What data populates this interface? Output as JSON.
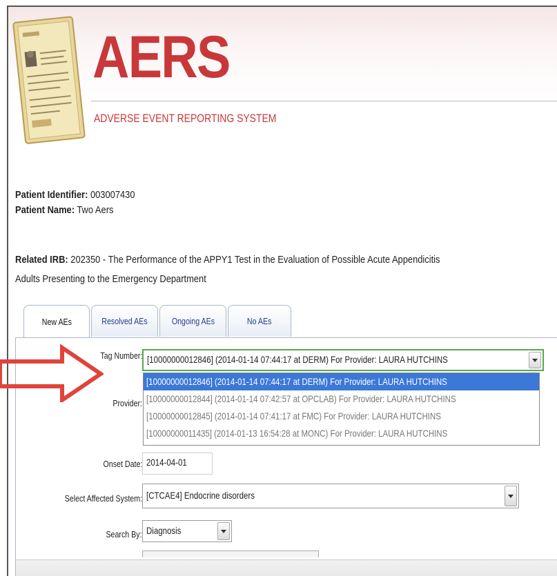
{
  "brand": {
    "title": "AERS",
    "subtitle": "ADVERSE EVENT REPORTING SYSTEM",
    "accent": "#c8383a"
  },
  "patient": {
    "identifier_label": "Patient Identifier:",
    "identifier_value": "003007430",
    "name_label": "Patient Name:",
    "name_value": "Two Aers"
  },
  "irb": {
    "label": "Related IRB:",
    "line1": "202350  - The Performance of the APPY1 Test in the Evaluation of Possible Acute Appendicitis",
    "line2": "Adults Presenting to the Emergency Department"
  },
  "tabs": [
    {
      "label": "New AEs",
      "active": true
    },
    {
      "label": "Resolved AEs",
      "active": false
    },
    {
      "label": "Ongoing AEs",
      "active": false
    },
    {
      "label": "No AEs",
      "active": false
    }
  ],
  "form": {
    "tag_number_label": "Tag Number:",
    "tag_number_value": "[10000000012846] (2014-01-14 07:44:17 at DERM) For Provider: LAURA HUTCHINS",
    "tag_options": [
      "[10000000012846] (2014-01-14 07:44:17 at DERM) For Provider: LAURA HUTCHINS",
      "[10000000012844] (2014-01-14 07:42:57 at OPCLAB) For Provider: LAURA HUTCHINS",
      "[10000000012845] (2014-01-14 07:41:17 at FMC) For Provider: LAURA HUTCHINS",
      "[10000000011435] (2014-01-13 16:54:28 at MONC) For Provider: LAURA HUTCHINS"
    ],
    "provider_label": "Provider:",
    "onset_date_label": "Onset Date:",
    "onset_date_value": "2014-04-01",
    "affected_system_label": "Select Affected System:",
    "affected_system_value": "[CTCAE4] Endocrine disorders",
    "search_by_label": "Search By:",
    "search_by_value": "Diagnosis"
  },
  "colors": {
    "highlight": "#3b78d8",
    "focus_border": "#56a84a",
    "annotation_arrow": "#e0443a"
  },
  "icons": {
    "logo": "folder-document-icon",
    "dropdown": "chevron-down-icon",
    "annotation": "red-arrow-icon"
  }
}
